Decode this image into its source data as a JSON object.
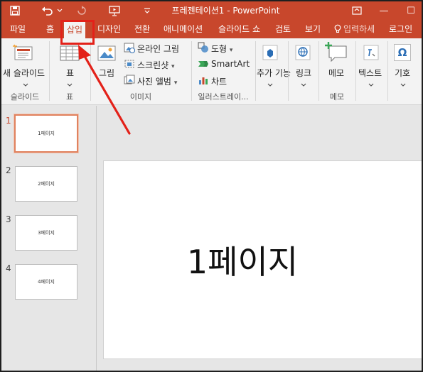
{
  "app": {
    "window_title": "프레젠테이션1 - PowerPoint"
  },
  "quick_access": {
    "save_icon": "save-icon",
    "undo_icon": "undo-icon",
    "redo_icon": "redo-icon",
    "from_beginning_icon": "slideshow-start-icon",
    "customize_icon": "customize-toolbar-icon"
  },
  "window_controls": {
    "ribbon_display_icon": "ribbon-display-options-icon",
    "minimize": "—",
    "maximize": "☐"
  },
  "tabs": [
    {
      "label": "파일"
    },
    {
      "label": "홈"
    },
    {
      "label": "삽입",
      "active": true
    },
    {
      "label": "디자인"
    },
    {
      "label": "전환"
    },
    {
      "label": "애니메이션"
    },
    {
      "label": "슬라이드 쇼"
    },
    {
      "label": "검토"
    },
    {
      "label": "보기"
    }
  ],
  "tell_me": {
    "placeholder": "입력하세"
  },
  "account": {
    "label": "로그인"
  },
  "ribbon": {
    "slides_group": {
      "new_slide_label": "새 슬라이드",
      "group_label": "슬라이드"
    },
    "tables_group": {
      "table_label": "표",
      "group_label": "표"
    },
    "images_group": {
      "picture_label": "그림",
      "online_pictures_label": "온라인 그림",
      "screenshot_label": "스크린샷",
      "photo_album_label": "사진 앨범",
      "group_label": "이미지"
    },
    "illustrations_group": {
      "shapes_label": "도형",
      "smartart_label": "SmartArt",
      "chart_label": "차트",
      "group_label": "일러스트레이..."
    },
    "addins_group": {
      "addins_label": "추가 기능"
    },
    "links_group": {
      "link_label": "링크"
    },
    "comments_group": {
      "comment_label": "메모",
      "group_label": "메모"
    },
    "text_group": {
      "text_label": "텍스트"
    },
    "symbols_group": {
      "symbols_label": "기호",
      "symbol_glyph": "Ω"
    }
  },
  "slides": [
    {
      "number": "1",
      "thumb_text": "1페이지",
      "active": true
    },
    {
      "number": "2",
      "thumb_text": "2페이지"
    },
    {
      "number": "3",
      "thumb_text": "3페이지"
    },
    {
      "number": "4",
      "thumb_text": "4페이지"
    }
  ],
  "current_slide": {
    "title": "1페이지"
  },
  "colors": {
    "accent": "#c8472c",
    "annotation": "#e32119"
  }
}
